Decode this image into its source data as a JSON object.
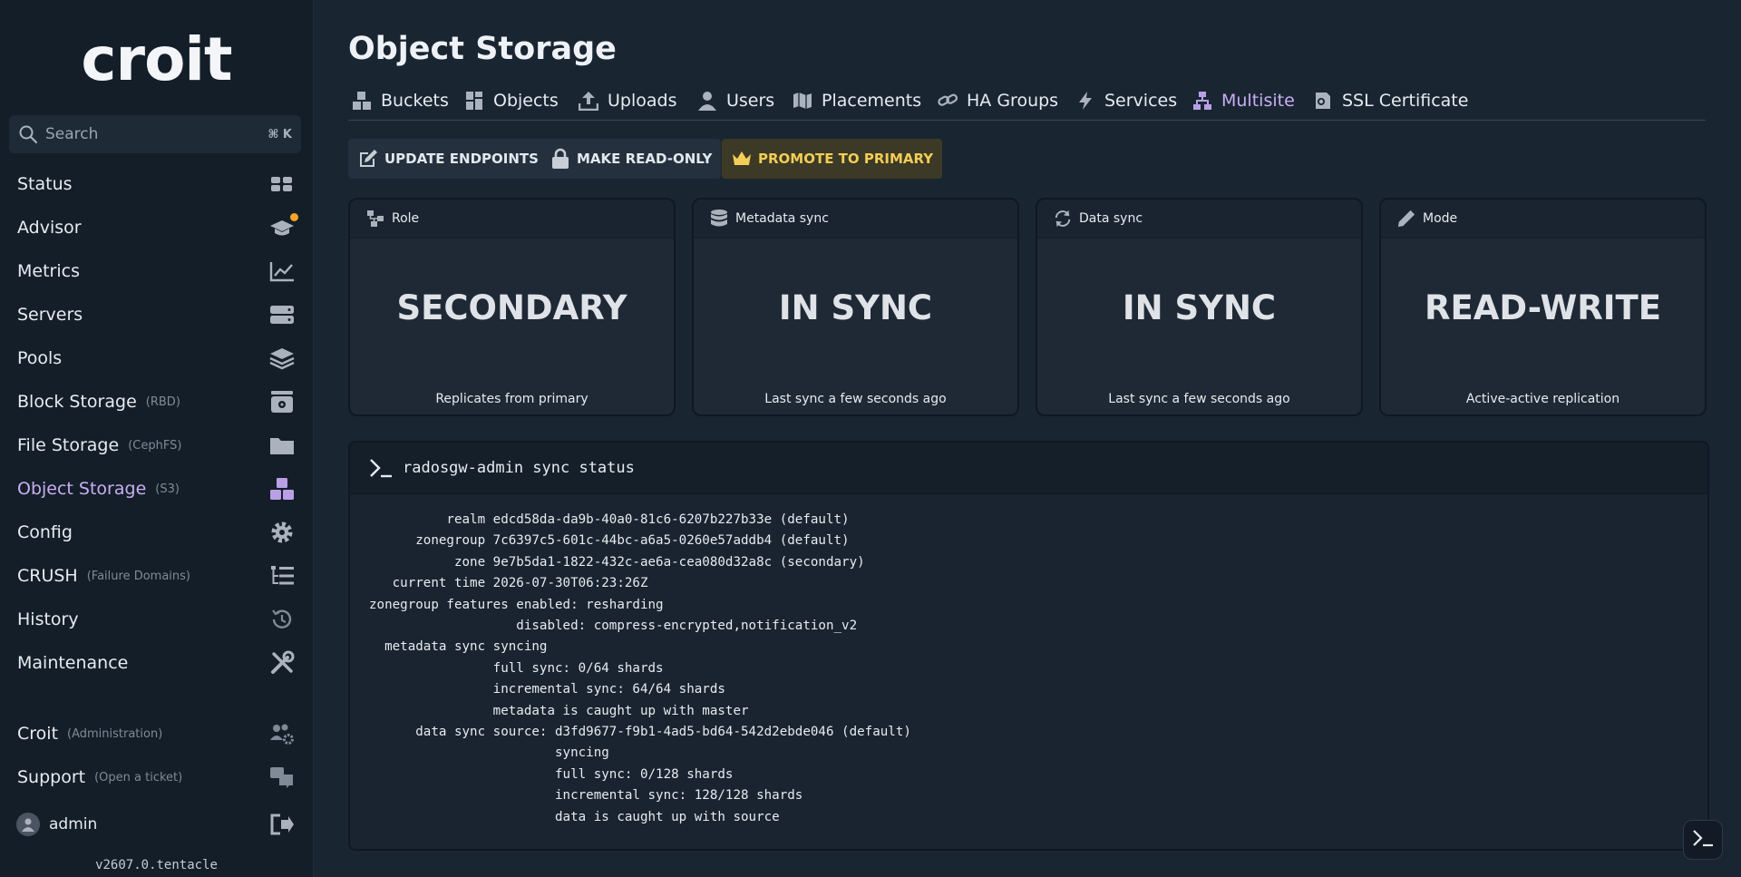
{
  "brand": {
    "logo_text": "croit",
    "version": "v2607.0.tentacle"
  },
  "search": {
    "placeholder": "Search",
    "shortcut": "⌘ K"
  },
  "sidebar": {
    "items": [
      {
        "label": "Status",
        "sub": "",
        "icon": "dashboard-icon"
      },
      {
        "label": "Advisor",
        "sub": "",
        "icon": "graduation-cap-icon"
      },
      {
        "label": "Metrics",
        "sub": "",
        "icon": "line-chart-icon"
      },
      {
        "label": "Servers",
        "sub": "",
        "icon": "server-icon"
      },
      {
        "label": "Pools",
        "sub": "",
        "icon": "layers-icon"
      },
      {
        "label": "Block Storage",
        "sub": "(RBD)",
        "icon": "disk-icon"
      },
      {
        "label": "File Storage",
        "sub": "(CephFS)",
        "icon": "folder-icon"
      },
      {
        "label": "Object Storage",
        "sub": "(S3)",
        "icon": "boxes-icon"
      },
      {
        "label": "Config",
        "sub": "",
        "icon": "gear-icon"
      },
      {
        "label": "CRUSH",
        "sub": "(Failure Domains)",
        "icon": "tree-icon"
      },
      {
        "label": "History",
        "sub": "",
        "icon": "history-icon"
      },
      {
        "label": "Maintenance",
        "sub": "",
        "icon": "tools-icon"
      },
      {
        "label": "Croit",
        "sub": "(Administration)",
        "icon": "users-gear-icon"
      },
      {
        "label": "Support",
        "sub": "(Open a ticket)",
        "icon": "chat-icon"
      }
    ],
    "user": "admin"
  },
  "page": {
    "title": "Object Storage"
  },
  "tabs": [
    {
      "label": "Buckets"
    },
    {
      "label": "Objects"
    },
    {
      "label": "Uploads"
    },
    {
      "label": "Users"
    },
    {
      "label": "Placements"
    },
    {
      "label": "HA Groups"
    },
    {
      "label": "Services"
    },
    {
      "label": "Multisite"
    },
    {
      "label": "SSL Certificate"
    }
  ],
  "actions": {
    "update_endpoints": "UPDATE ENDPOINTS",
    "make_read_only": "MAKE READ-ONLY",
    "promote": "PROMOTE TO PRIMARY"
  },
  "cards": [
    {
      "label": "Role",
      "value": "SECONDARY",
      "note": "Replicates from primary"
    },
    {
      "label": "Metadata sync",
      "value": "IN SYNC",
      "note": "Last sync a few seconds ago"
    },
    {
      "label": "Data sync",
      "value": "IN SYNC",
      "note": "Last sync a few seconds ago"
    },
    {
      "label": "Mode",
      "value": "READ-WRITE",
      "note": "Active-active replication"
    }
  ],
  "terminal": {
    "command": "radosgw-admin sync status",
    "output": "          realm edcd58da-da9b-40a0-81c6-6207b227b33e (default)\n      zonegroup 7c6397c5-601c-44bc-a6a5-0260e57addb4 (default)\n           zone 9e7b5da1-1822-432c-ae6a-cea080d32a8c (secondary)\n   current time 2026-07-30T06:23:26Z\nzonegroup features enabled: resharding\n                   disabled: compress-encrypted,notification_v2\n  metadata sync syncing\n                full sync: 0/64 shards\n                incremental sync: 64/64 shards\n                metadata is caught up with master\n      data sync source: d3fd9677-f9b1-4ad5-bd64-542d2ebde046 (default)\n                        syncing\n                        full sync: 0/128 shards\n                        incremental sync: 128/128 shards\n                        data is caught up with source"
  },
  "colors": {
    "accent": "#c8aef0",
    "warning": "#f3cd57",
    "notify": "#f5a524"
  }
}
